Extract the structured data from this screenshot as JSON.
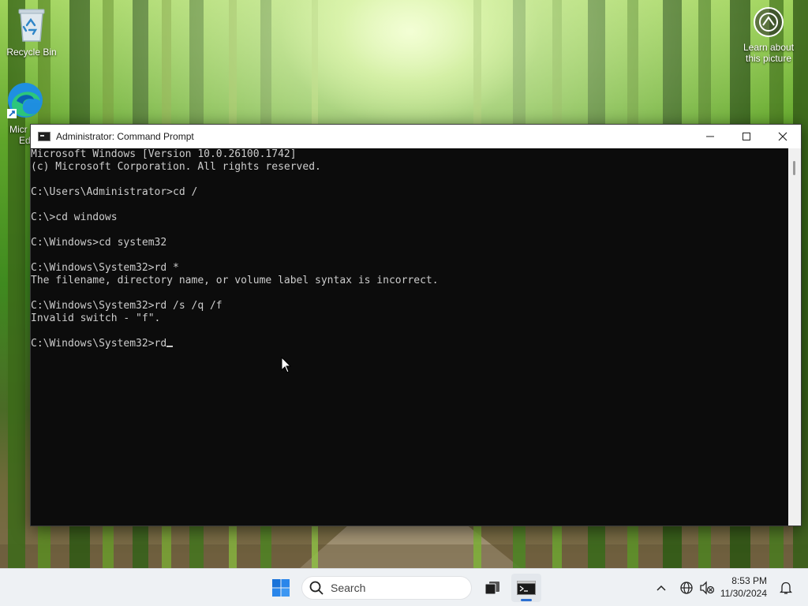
{
  "desktop": {
    "icons": [
      {
        "label": "Recycle Bin",
        "icon": "recycle-bin-icon"
      },
      {
        "label": "Micr… Ed…",
        "label_line1": "Micr",
        "label_line2": "Ed",
        "icon": "edge-icon"
      }
    ],
    "spotlight": {
      "line1": "Learn about",
      "line2": "this picture",
      "icon": "camera-info-icon"
    }
  },
  "window": {
    "title": "Administrator: Command Prompt",
    "icon": "cmd-icon",
    "controls": {
      "minimize": "minimize-icon",
      "maximize": "maximize-icon",
      "close": "close-icon"
    }
  },
  "console": {
    "lines": [
      "Microsoft Windows [Version 10.0.26100.1742]",
      "(c) Microsoft Corporation. All rights reserved.",
      "",
      "C:\\Users\\Administrator>cd /",
      "",
      "C:\\>cd windows",
      "",
      "C:\\Windows>cd system32",
      "",
      "C:\\Windows\\System32>rd *",
      "The filename, directory name, or volume label syntax is incorrect.",
      "",
      "C:\\Windows\\System32>rd /s /q /f",
      "Invalid switch - \"f\".",
      ""
    ],
    "prompt_line": "C:\\Windows\\System32>rd"
  },
  "taskbar": {
    "search_placeholder": "Search",
    "pinned": [
      "start-icon",
      "search-icon",
      "task-view-icon",
      "cmd-icon"
    ],
    "tray_icons": [
      "chevron-up-icon",
      "network-icon",
      "volume-muted-icon",
      "notification-bell-icon"
    ],
    "clock": {
      "time": "8:53 PM",
      "date": "11/30/2024"
    }
  },
  "colors": {
    "console_bg": "#0c0c0c",
    "console_text": "#cccccc",
    "taskbar_bg": "#eef1f4",
    "accent": "#2b6fd1"
  }
}
